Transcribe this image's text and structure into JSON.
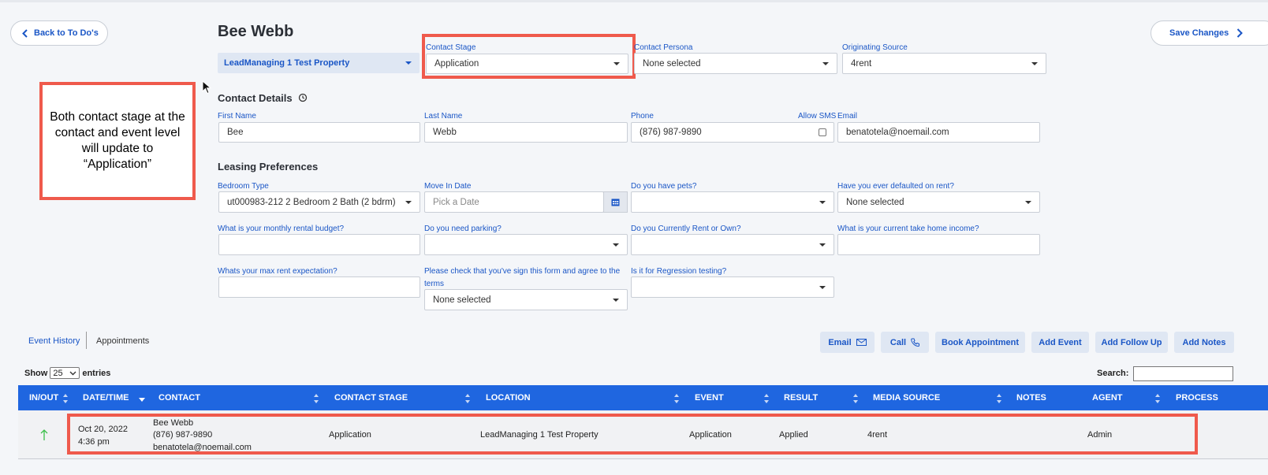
{
  "nav": {
    "back_label": "Back to To Do's",
    "save_label": "Save Changes"
  },
  "contact": {
    "name": "Bee Webb"
  },
  "property_select": {
    "value": "LeadManaging 1 Test Property"
  },
  "contact_stage": {
    "label": "Contact Stage",
    "value": "Application"
  },
  "contact_persona": {
    "label": "Contact Persona",
    "value": "None selected"
  },
  "originating_source": {
    "label": "Originating Source",
    "value": "4rent"
  },
  "callout": {
    "text": "Both contact stage at the contact and event level will update to “Application”"
  },
  "contact_details": {
    "heading": "Contact Details",
    "first_name": {
      "label": "First Name",
      "value": "Bee"
    },
    "last_name": {
      "label": "Last Name",
      "value": "Webb"
    },
    "phone": {
      "label": "Phone",
      "value": "(876) 987-9890"
    },
    "allow_sms": {
      "label": "Allow SMS",
      "checked": false
    },
    "email": {
      "label": "Email",
      "value": "benatotela@noemail.com"
    }
  },
  "leasing": {
    "heading": "Leasing Preferences",
    "bedroom_type": {
      "label": "Bedroom Type",
      "value": "ut000983-212 2 Bedroom 2 Bath (2 bdrm)"
    },
    "move_in": {
      "label": "Move In Date",
      "placeholder": "Pick a Date"
    },
    "pets": {
      "label": "Do you have pets?",
      "value": ""
    },
    "defaulted": {
      "label": "Have you ever defaulted on rent?",
      "value": "None selected"
    },
    "budget": {
      "label": "What is your monthly rental budget?",
      "value": ""
    },
    "parking": {
      "label": "Do you need parking?",
      "value": ""
    },
    "rent_own": {
      "label": "Do you Currently Rent or Own?",
      "value": ""
    },
    "income": {
      "label": "What is your current take home income?",
      "value": ""
    },
    "max_rent": {
      "label": "Whats your max rent expectation?",
      "value": ""
    },
    "terms": {
      "label_line1": "Please check that you've sign this form and agree to the",
      "label_line2": "terms",
      "value": "None selected"
    },
    "regression": {
      "label": "Is it for Regression testing?",
      "value": ""
    }
  },
  "tabs": {
    "event_history": "Event History",
    "appointments": "Appointments"
  },
  "actions": {
    "email": "Email",
    "call": "Call",
    "book": "Book Appointment",
    "add_event": "Add Event",
    "add_follow_up": "Add Follow Up",
    "add_notes": "Add Notes"
  },
  "table_controls": {
    "show": "Show",
    "entries_value": "25",
    "entries": "entries",
    "search": "Search:"
  },
  "table": {
    "columns": [
      "IN/OUT",
      "DATE/TIME",
      "CONTACT",
      "CONTACT STAGE",
      "LOCATION",
      "EVENT",
      "RESULT",
      "MEDIA SOURCE",
      "NOTES",
      "AGENT",
      "PROCESS"
    ],
    "row": {
      "date": "Oct 20, 2022",
      "time": "4:36 pm",
      "contact_name": "Bee Webb",
      "contact_phone": "(876) 987-9890",
      "contact_email": "benatotela@noemail.com",
      "stage": "Application",
      "location": "LeadManaging 1 Test Property",
      "event": "Application",
      "result": "Applied",
      "media_source": "4rent",
      "notes": "",
      "agent": "Admin",
      "process": ""
    }
  },
  "colors": {
    "accent": "#1a56c6",
    "table_header": "#1f66e0",
    "highlight": "#ef5a4c",
    "direction_arrow": "#3bbf4a"
  }
}
